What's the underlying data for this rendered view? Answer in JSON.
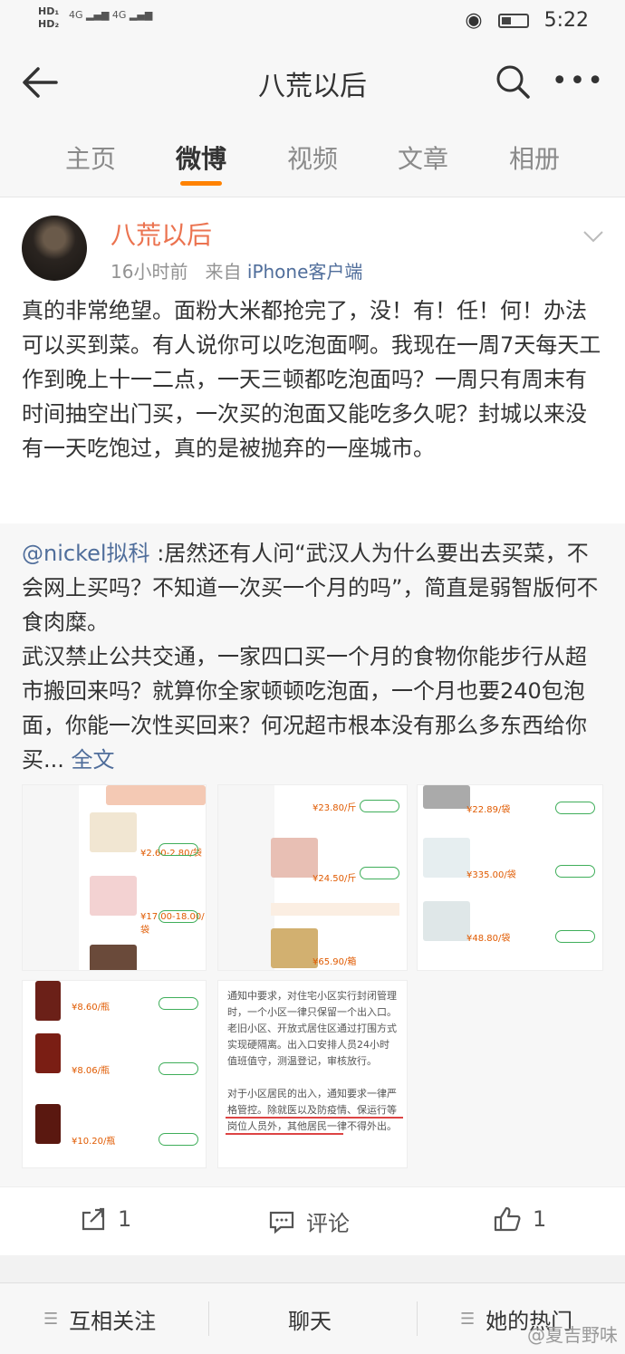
{
  "status_bar": {
    "network": "4G",
    "time": "5:22"
  },
  "header": {
    "title": "八荒以后"
  },
  "tabs": [
    "主页",
    "微博",
    "视频",
    "文章",
    "相册"
  ],
  "post": {
    "username": "八荒以后",
    "time": "16小时前",
    "from_prefix": "来自",
    "source": "iPhone客户端",
    "text": "真的非常绝望。面粉大米都抢完了，没！有！任！何！办法可以买到菜。有人说你可以吃泡面啊。我现在一周7天每天工作到晚上十一二点，一天三顿都吃泡面吗？一周只有周末有时间抽空出门买，一次买的泡面又能吃多久呢？封城以来没有一天吃饱过，真的是被抛弃的一座城市。"
  },
  "repost": {
    "mention": "@nickel拟科",
    "text": " :居然还有人问“武汉人为什么要出去买菜，不会网上买吗？不知道一次买一个月的吗”，简直是弱智版何不食肉糜。\n武汉禁止公共交通，一家四口买一个月的食物你能步行从超市搬回来吗？就算你全家顿顿吃泡面，一个月也要240包泡面，你能一次性买回来？何况超市根本没有那么多东西给你买...",
    "more": "全文"
  },
  "actions": {
    "repost_count": "1",
    "comment_label": "评论",
    "like_count": "1"
  },
  "bottom_bar": {
    "follow": "互相关注",
    "chat": "聊天",
    "hot": "她的热门"
  },
  "watermark": "@夏吉野味",
  "colors": {
    "accent": "#ff8200",
    "username": "#eb7350",
    "link": "#506e9b"
  }
}
